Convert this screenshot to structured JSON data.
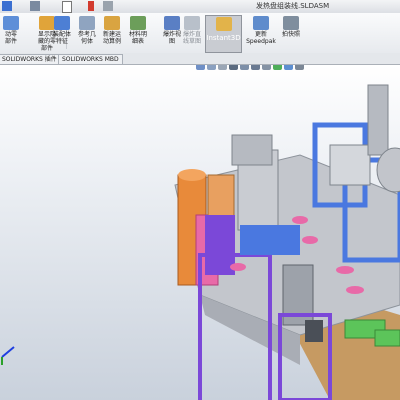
{
  "window": {
    "title": "发热盘组装线.SLDASM"
  },
  "quick_access": {
    "icons": [
      "document-icon",
      "grid-icon",
      "cursor-icon",
      "traffic-light-icon",
      "options-icon"
    ]
  },
  "ribbon": {
    "buttons": [
      {
        "label": "动零\n部件",
        "icon": "move-component-icon"
      },
      {
        "label": "显示隐\n藏的零\n部件",
        "icon": "show-hidden-icon"
      },
      {
        "label": "装配体\n特征",
        "icon": "assembly-features-icon"
      },
      {
        "label": "参考几\n何体",
        "icon": "reference-geometry-icon"
      },
      {
        "label": "新建运\n动算例",
        "icon": "motion-study-icon"
      },
      {
        "label": "材料明\n细表",
        "icon": "bill-of-materials-icon"
      },
      {
        "label": "爆炸视\n图",
        "icon": "exploded-view-icon"
      },
      {
        "label": "爆炸直\n线草图",
        "icon": "explode-line-sketch-icon",
        "disabled": true
      },
      {
        "label": "Instant3D",
        "icon": "instant3d-icon",
        "active": true
      },
      {
        "label": "更新\nSpeedpak",
        "icon": "speedpak-icon"
      },
      {
        "label": "拍快照",
        "icon": "snapshot-icon"
      }
    ]
  },
  "tabs": [
    "SOLIDWORKS 插件",
    "SOLIDWORKS MBD"
  ],
  "viewport": {
    "heads_up_icons": [
      "zoom-fit-icon",
      "zoom-area-icon",
      "previous-view-icon",
      "section-view-icon",
      "view-orientation-icon",
      "display-style-icon",
      "hide-show-icon",
      "edit-appearance-icon",
      "scene-icon",
      "view-settings-icon"
    ],
    "colors": {
      "frame_blue": "#4a78e0",
      "panel_grey": "#c3c6cc",
      "machine_purple": "#7b48d8",
      "part_orange": "#e88a3a",
      "part_pink": "#e86aa8",
      "wood": "#c69a62",
      "green_part": "#5cc45a"
    }
  }
}
